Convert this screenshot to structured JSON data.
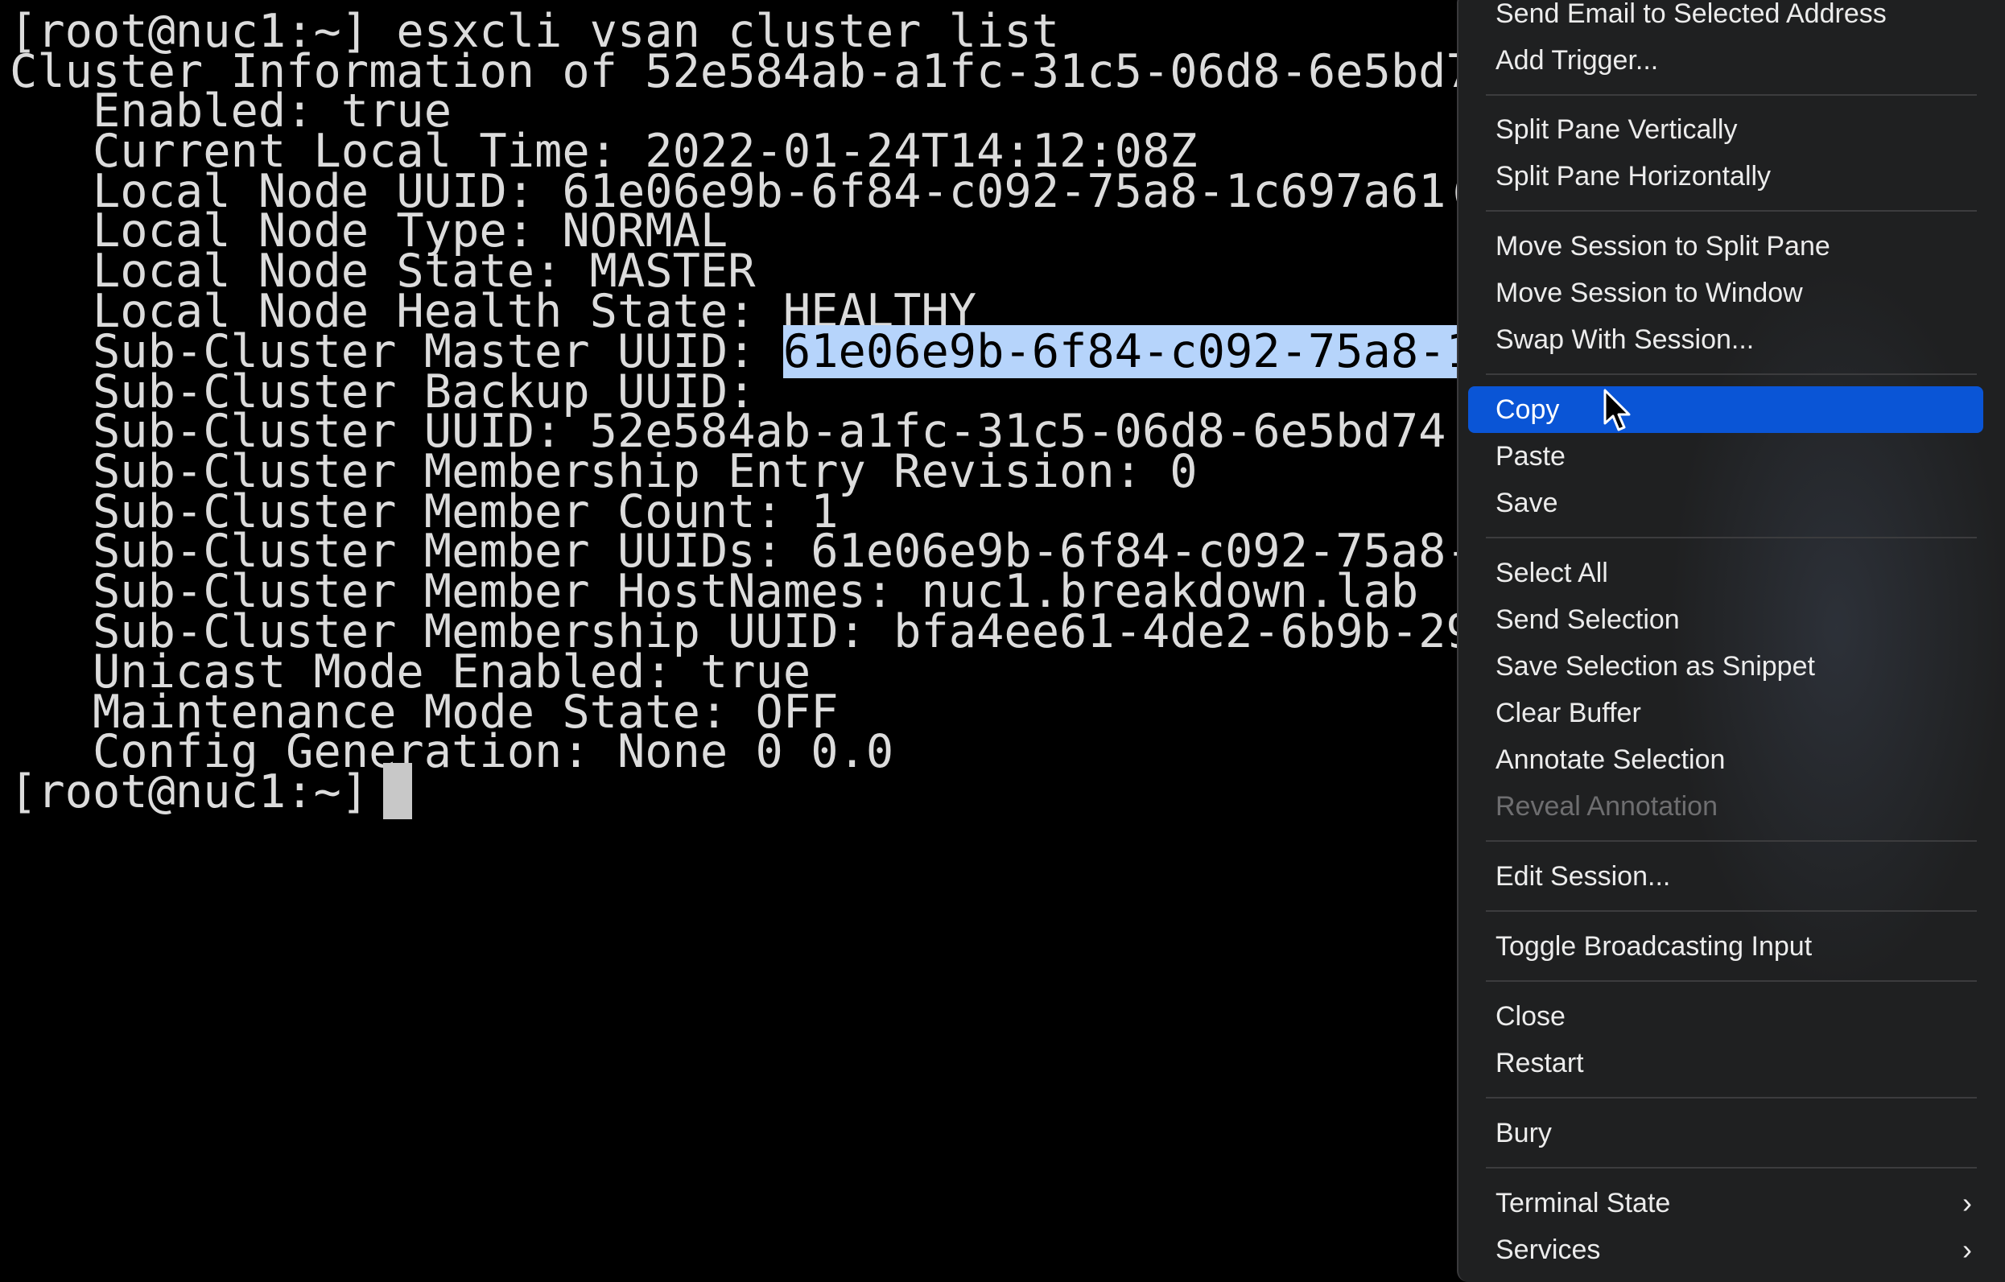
{
  "terminal": {
    "lines": [
      "[root@nuc1:~] esxcli vsan cluster list",
      "Cluster Information of 52e584ab-a1fc-31c5-06d8-6e5bd7",
      "   Enabled: true",
      "   Current Local Time: 2022-01-24T14:12:08Z",
      "   Local Node UUID: 61e06e9b-6f84-c092-75a8-1c697a61(",
      "   Local Node Type: NORMAL",
      "   Local Node State: MASTER",
      "   Local Node Health State: HEALTHY"
    ],
    "master_label": "   Sub-Cluster Master UUID: ",
    "master_value": "61e06e9b-6f84-c092-75a8-1",
    "lines_after": [
      "   Sub-Cluster Backup UUID:",
      "   Sub-Cluster UUID: 52e584ab-a1fc-31c5-06d8-6e5bd74",
      "   Sub-Cluster Membership Entry Revision: 0",
      "   Sub-Cluster Member Count: 1",
      "   Sub-Cluster Member UUIDs: 61e06e9b-6f84-c092-75a8-",
      "   Sub-Cluster Member HostNames: nuc1.breakdown.lab",
      "   Sub-Cluster Membership UUID: bfa4ee61-4de2-6b9b-29",
      "   Unicast Mode Enabled: true",
      "   Maintenance Mode State: OFF",
      "   Config Generation: None 0 0.0"
    ],
    "prompt": "[root@nuc1:~]"
  },
  "context_menu": {
    "items": [
      "Send Email to Selected Address",
      "Add Trigger...",
      "Split Pane Vertically",
      "Split Pane Horizontally",
      "Move Session to Split Pane",
      "Move Session to Window",
      "Swap With Session...",
      "Copy",
      "Paste",
      "Save",
      "Select All",
      "Send Selection",
      "Save Selection as Snippet",
      "Clear Buffer",
      "Annotate Selection",
      "Reveal Annotation",
      "Edit Session...",
      "Toggle Broadcasting Input",
      "Close",
      "Restart",
      "Bury",
      "Terminal State",
      "Services"
    ],
    "highlighted_item": "Copy",
    "disabled_item": "Reveal Annotation",
    "submenu_arrow": "›"
  },
  "colors": {
    "highlight": "#0a55d6",
    "selection": "#b6d4fb"
  }
}
